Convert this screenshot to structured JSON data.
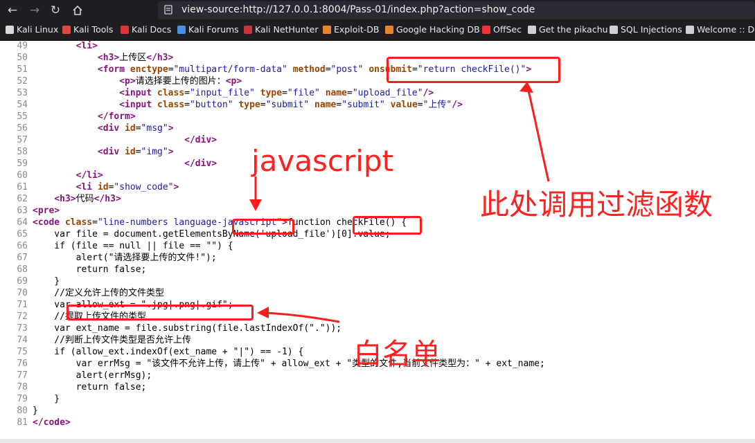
{
  "browser": {
    "url": "view-source:http://127.0.0.1:8004/Pass-01/index.php?action=show_code",
    "nav_icons": [
      "back-arrow-icon",
      "forward-arrow-icon",
      "reload-icon",
      "home-icon"
    ]
  },
  "bookmarks": [
    {
      "label": "Kali Linux",
      "color": "#d9d9d9"
    },
    {
      "label": "Kali Tools",
      "color": "#e04646"
    },
    {
      "label": "Kali Docs",
      "color": "#d33"
    },
    {
      "label": "Kali Forums",
      "color": "#4a90e2"
    },
    {
      "label": "Kali NetHunter",
      "color": "#c33"
    },
    {
      "label": "Exploit-DB",
      "color": "#e8842a"
    },
    {
      "label": "Google Hacking DB",
      "color": "#e8842a"
    },
    {
      "label": "OffSec",
      "color": "#e33"
    },
    {
      "label": "Get the pikachu",
      "color": "#cfcfd4"
    },
    {
      "label": "SQL Injections",
      "color": "#cfcfd4"
    },
    {
      "label": "Welcome :: Da",
      "color": "#cfcfd4"
    }
  ],
  "code_lines": [
    {
      "n": "49",
      "html": "        <span class=\"tag\">&lt;li&gt;</span>"
    },
    {
      "n": "50",
      "html": "            <span class=\"tag\">&lt;h3&gt;</span>上传区<span class=\"tag\">&lt;/h3&gt;</span>"
    },
    {
      "n": "51",
      "html": "            <span class=\"tag\">&lt;form</span> <span class=\"attr\">enctype</span>=<span class=\"val\">\"multipart/form-data\"</span> <span class=\"attr\">method</span>=<span class=\"val\">\"post\"</span> <span class=\"attr\">onsubmit</span>=<span class=\"val\">\"return checkFile()\"</span><span class=\"tag\">&gt;</span>"
    },
    {
      "n": "52",
      "html": "                <span class=\"tag\">&lt;p&gt;</span>请选择要上传的图片：<span class=\"tag\">&lt;p&gt;</span>"
    },
    {
      "n": "53",
      "html": "                <span class=\"tag\">&lt;input</span> <span class=\"attr\">class</span>=<span class=\"val\">\"input_file\"</span> <span class=\"attr\">type</span>=<span class=\"val\">\"file\"</span> <span class=\"attr\">name</span>=<span class=\"val\">\"upload_file\"</span><span class=\"tag\">/&gt;</span>"
    },
    {
      "n": "54",
      "html": "                <span class=\"tag\">&lt;input</span> <span class=\"attr\">class</span>=<span class=\"val\">\"button\"</span> <span class=\"attr\">type</span>=<span class=\"val\">\"submit\"</span> <span class=\"attr\">name</span>=<span class=\"val\">\"submit\"</span> <span class=\"attr\">value</span>=<span class=\"val\">\"上传\"</span><span class=\"tag\">/&gt;</span>"
    },
    {
      "n": "55",
      "html": "            <span class=\"tag\">&lt;/form&gt;</span>"
    },
    {
      "n": "56",
      "html": "            <span class=\"tag\">&lt;div</span> <span class=\"attr\">id</span>=<span class=\"val\">\"msg\"</span><span class=\"tag\">&gt;</span>"
    },
    {
      "n": "57",
      "html": "                            <span class=\"tag\">&lt;/div&gt;</span>"
    },
    {
      "n": "58",
      "html": "            <span class=\"tag\">&lt;div</span> <span class=\"attr\">id</span>=<span class=\"val\">\"img\"</span><span class=\"tag\">&gt;</span>"
    },
    {
      "n": "59",
      "html": "                            <span class=\"tag\">&lt;/div&gt;</span>"
    },
    {
      "n": "60",
      "html": "        <span class=\"tag\">&lt;/li&gt;</span>"
    },
    {
      "n": "61",
      "html": "        <span class=\"tag\">&lt;li</span> <span class=\"attr\">id</span>=<span class=\"val\">\"show_code\"</span><span class=\"tag\">&gt;</span>"
    },
    {
      "n": "62",
      "html": "    <span class=\"tag\">&lt;h3&gt;</span>代码<span class=\"tag\">&lt;/h3&gt;</span>"
    },
    {
      "n": "63",
      "html": "<span class=\"tag\">&lt;pre&gt;</span>"
    },
    {
      "n": "64",
      "html": "<span class=\"tag\">&lt;code</span> <span class=\"attr\">class</span>=<span class=\"val\">\"line-numbers language-javascript\"</span><span class=\"tag\">&gt;</span>function checkFile() {"
    },
    {
      "n": "65",
      "html": "    var file = document.getElementsByName('upload_file')[0].value;"
    },
    {
      "n": "66",
      "html": "    if (file == null || file == \"\") {"
    },
    {
      "n": "67",
      "html": "        alert(\"请选择要上传的文件!\");"
    },
    {
      "n": "68",
      "html": "        return false;"
    },
    {
      "n": "69",
      "html": "    }"
    },
    {
      "n": "70",
      "html": "    //定义允许上传的文件类型"
    },
    {
      "n": "71",
      "html": "    var allow_ext = \".jpg|.png|.gif\";"
    },
    {
      "n": "72",
      "html": "    //提取上传文件的类型"
    },
    {
      "n": "73",
      "html": "    var ext_name = file.substring(file.lastIndexOf(\".\"));"
    },
    {
      "n": "74",
      "html": "    //判断上传文件类型是否允许上传"
    },
    {
      "n": "75",
      "html": "    if (allow_ext.indexOf(ext_name + \"|\") == -1) {"
    },
    {
      "n": "76",
      "html": "        var errMsg = \"该文件不允许上传，请上传\" + allow_ext + \"类型的文件,当前文件类型为：\" + ext_name;"
    },
    {
      "n": "77",
      "html": "        alert(errMsg);"
    },
    {
      "n": "78",
      "html": "        return false;"
    },
    {
      "n": "79",
      "html": "    }"
    },
    {
      "n": "80",
      "html": "}"
    },
    {
      "n": "81",
      "html": "<span class=\"tag\">&lt;/code&gt;</span>"
    }
  ],
  "annotations": {
    "javascript_label": "javascript",
    "filter_label": "此处调用过滤函数",
    "whitelist_label": "白名单"
  },
  "colors": {
    "annotation": "#ff1c1c",
    "tag": "#881280",
    "attribute": "#994500",
    "value": "#1a1aa6"
  }
}
